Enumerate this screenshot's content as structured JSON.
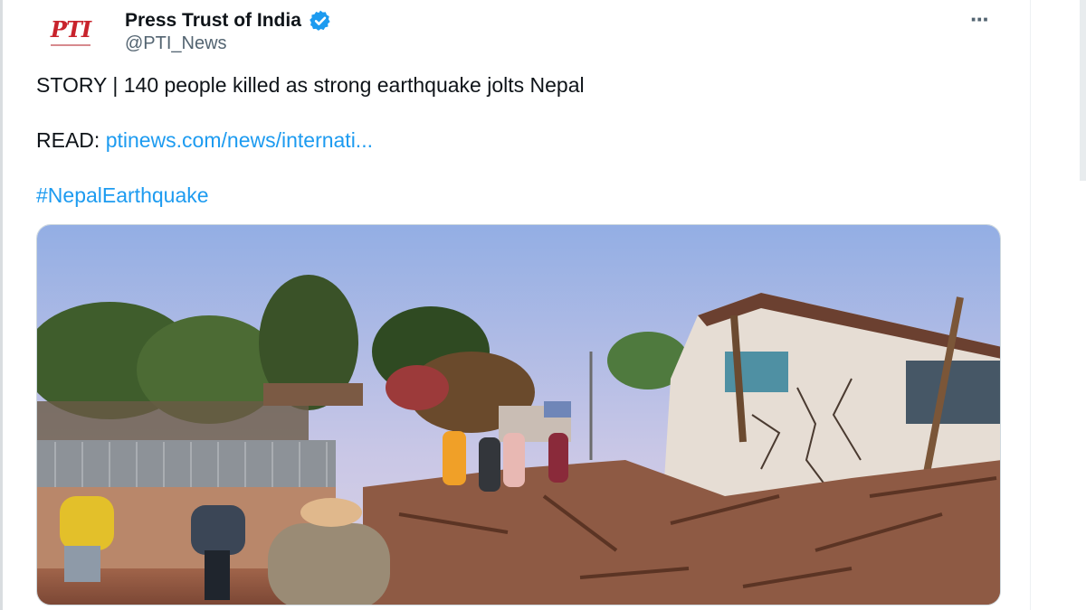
{
  "account": {
    "display_name": "Press Trust of India",
    "handle": "@PTI_News",
    "avatar_text": "PTI",
    "verified_icon": "verified-badge-icon",
    "more_icon": "more-options-icon"
  },
  "tweet": {
    "story_text": "STORY | 140 people killed as strong earthquake jolts Nepal",
    "read_label": "READ:",
    "read_link": "ptinews.com/news/internati...",
    "hashtag": "#NepalEarthquake"
  },
  "colors": {
    "link": "#1d9bf0",
    "text": "#0f1419",
    "secondary": "#536471",
    "verified": "#1d9bf0",
    "logo": "#c8232c"
  }
}
